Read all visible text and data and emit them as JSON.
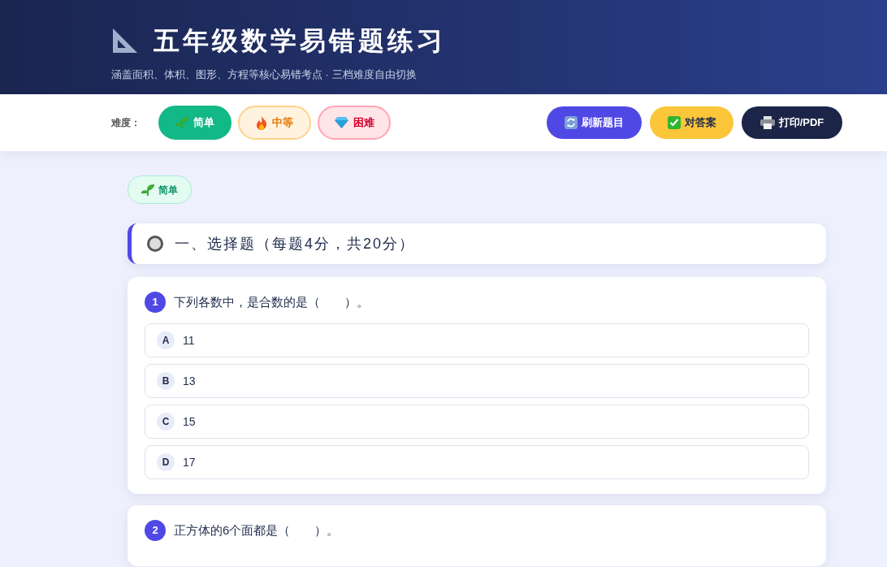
{
  "header": {
    "title": "五年级数学易错题练习",
    "subtitle": "涵盖面积、体积、图形、方程等核心易错考点 · 三档难度自由切换"
  },
  "toolbar": {
    "difficulty_label": "难度：",
    "difficulties": [
      {
        "kind": "easy",
        "label": "简单",
        "selected": true
      },
      {
        "kind": "medium",
        "label": "中等",
        "selected": false
      },
      {
        "kind": "hard",
        "label": "困难",
        "selected": false
      }
    ],
    "actions": [
      {
        "kind": "refresh",
        "label": "刷新题目"
      },
      {
        "kind": "answers",
        "label": "对答案"
      },
      {
        "kind": "print",
        "label": "打印/PDF"
      }
    ]
  },
  "current_level": {
    "kind": "easy",
    "label": "简单"
  },
  "section": {
    "title": "一、选择题（每题4分，共20分）"
  },
  "questions": [
    {
      "number": "1",
      "text": "下列各数中，是合数的是（　　）。",
      "options": [
        {
          "letter": "A",
          "text": "11"
        },
        {
          "letter": "B",
          "text": "13"
        },
        {
          "letter": "C",
          "text": "15"
        },
        {
          "letter": "D",
          "text": "17"
        }
      ]
    },
    {
      "number": "2",
      "text": "正方体的6个面都是（　　）。"
    }
  ]
}
